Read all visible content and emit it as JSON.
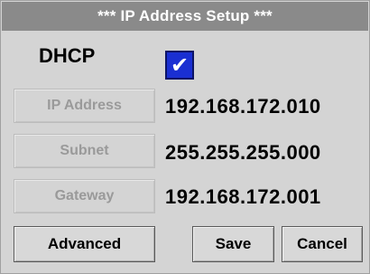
{
  "window": {
    "title": "***  IP Address Setup ***"
  },
  "dhcp": {
    "label": "DHCP",
    "checked": true,
    "check_glyph": "✔"
  },
  "fields": [
    {
      "label": "IP Address",
      "value": "192.168.172.010"
    },
    {
      "label": "Subnet",
      "value": "255.255.255.000"
    },
    {
      "label": "Gateway",
      "value": "192.168.172.001"
    }
  ],
  "buttons": {
    "advanced": "Advanced",
    "save": "Save",
    "cancel": "Cancel"
  },
  "colors": {
    "title_bar": "#8a8a8a",
    "checkbox": "#1a2fd2",
    "background": "#d4d4d4"
  }
}
